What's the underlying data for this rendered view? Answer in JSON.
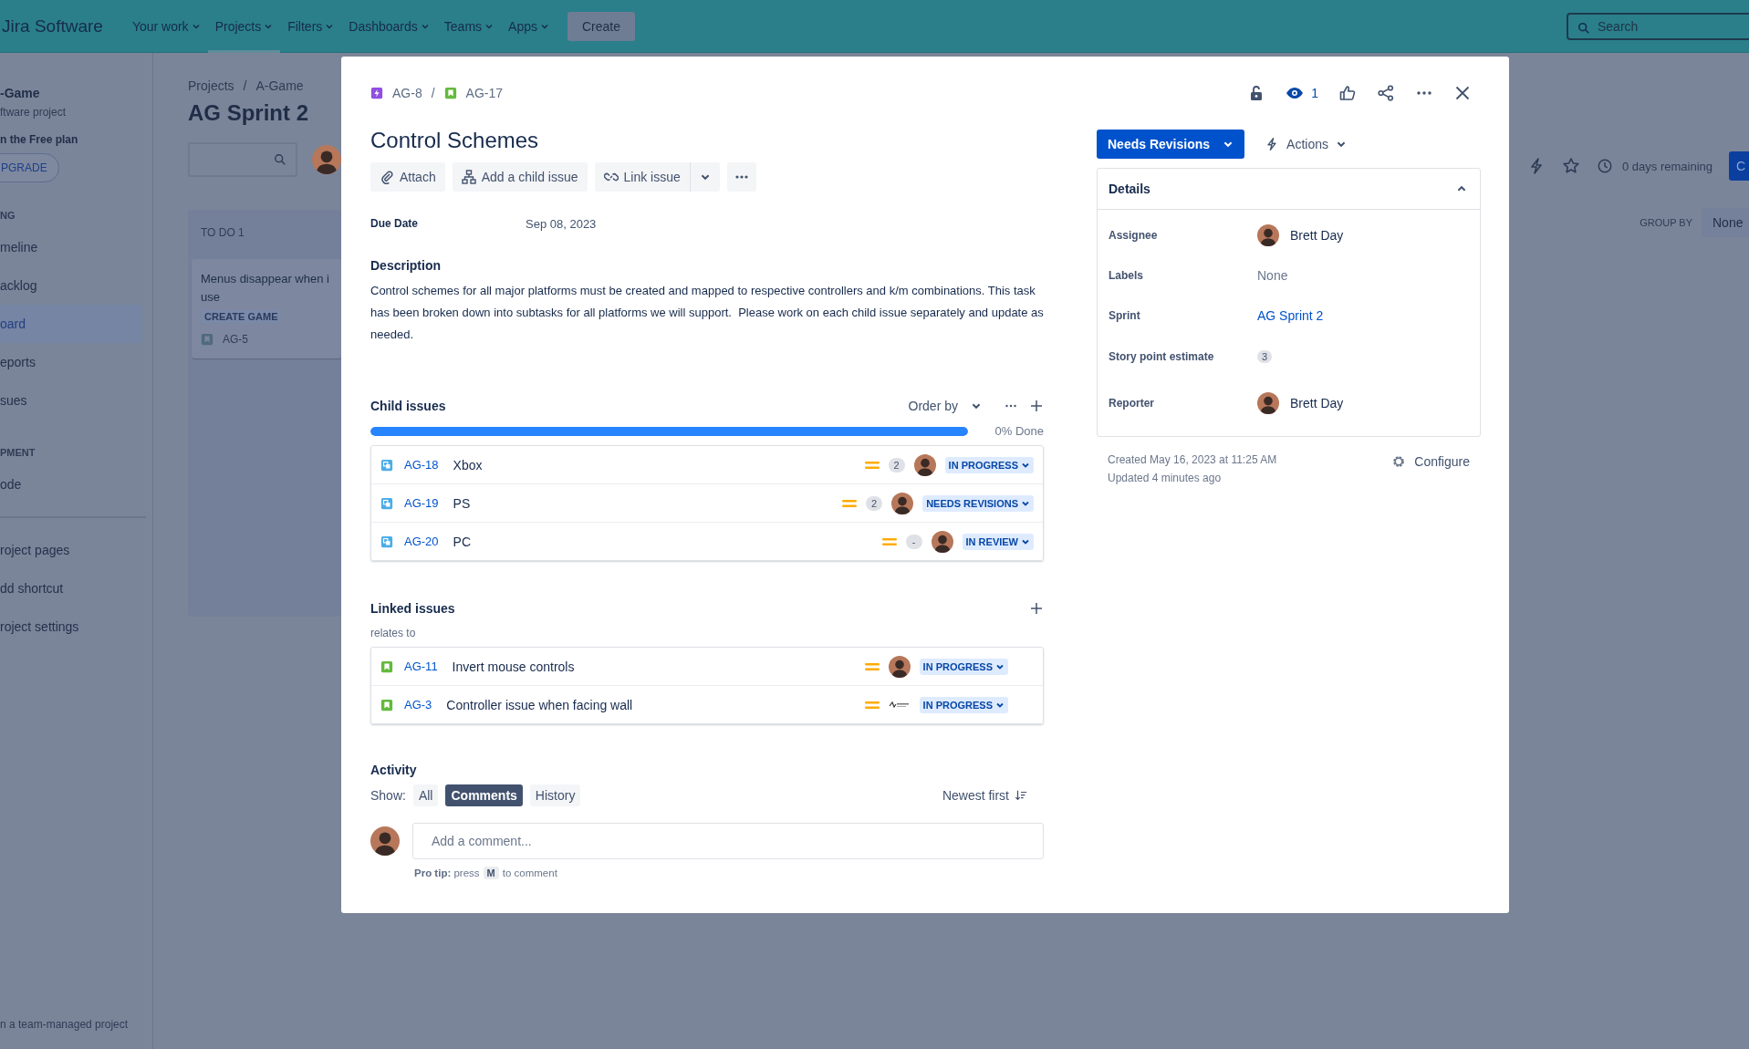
{
  "top_nav": {
    "product": "Jira Software",
    "items": [
      {
        "label": "Your work",
        "selected": false
      },
      {
        "label": "Projects",
        "selected": true
      },
      {
        "label": "Filters",
        "selected": false
      },
      {
        "label": "Dashboards",
        "selected": false
      },
      {
        "label": "Teams",
        "selected": false
      },
      {
        "label": "Apps",
        "selected": false
      }
    ],
    "create_button": "Create",
    "search": {
      "placeholder": "Search"
    }
  },
  "sidebar": {
    "project_name": "-Game",
    "project_type": "ftware project",
    "plan_note": "n the Free plan",
    "upgrade_button": "PGRADE",
    "sections": [
      {
        "heading": "NG",
        "items": [
          {
            "label": "meline",
            "selected": false
          },
          {
            "label": "acklog",
            "selected": false
          },
          {
            "label": "oard",
            "selected": true
          },
          {
            "label": "eports",
            "selected": false
          },
          {
            "label": "sues",
            "selected": false
          }
        ]
      },
      {
        "heading": "PMENT",
        "items": [
          {
            "label": "ode",
            "selected": false
          }
        ]
      }
    ],
    "links": [
      "roject pages",
      "dd shortcut",
      "roject settings"
    ],
    "footer": "n a team-managed project"
  },
  "board": {
    "breadcrumbs": [
      "Projects",
      "/",
      "A-Game"
    ],
    "title": "AG Sprint 2",
    "column": {
      "title": "TO DO 1",
      "card": {
        "title": "Menus disappear when i use",
        "epic": "CREATE GAME",
        "key": "AG-5"
      }
    },
    "days_remaining": "0 days remaining",
    "complete_button": "C",
    "group_by_label": "GROUP BY",
    "group_by_value": "None"
  },
  "issue": {
    "breadcrumbs": [
      "AG-8",
      "AG-17"
    ],
    "breadcrumb_separator": "/",
    "watchers": "1",
    "title": "Control Schemes",
    "toolbar": [
      "Attach",
      "Add a child issue",
      "Link issue"
    ],
    "due_date_label": "Due Date",
    "due_date": "Sep 08, 2023",
    "description_label": "Description",
    "description": "Control schemes for all major platforms must be created and mapped to respective controllers and k/m combinations. This task has been broken down into subtasks for all platforms we will support.  Please work on each child issue separately and update as needed.",
    "child_issues": {
      "title": "Child issues",
      "order_by": "Order by",
      "progress": {
        "level": 1,
        "reading": "0% Done"
      },
      "rows": [
        {
          "key": "AG-18",
          "summary": "Xbox",
          "story_points": "2",
          "status": "IN PROGRESS"
        },
        {
          "key": "AG-19",
          "summary": "PS",
          "story_points": "2",
          "status": "NEEDS REVISIONS"
        },
        {
          "key": "AG-20",
          "summary": "PC",
          "story_points": "-",
          "status": "IN REVIEW"
        }
      ]
    },
    "linked_issues": {
      "title": "Linked issues",
      "relation": "relates to",
      "rows": [
        {
          "key": "AG-11",
          "summary": "Invert mouse controls",
          "kind": "person",
          "status": "IN PROGRESS"
        },
        {
          "key": "AG-3",
          "summary": "Controller issue when facing wall",
          "kind": "logo",
          "status": "IN PROGRESS"
        }
      ]
    },
    "activity": {
      "title": "Activity",
      "show_label": "Show:",
      "filters": [
        {
          "label": "All",
          "selected": false
        },
        {
          "label": "Comments",
          "selected": true
        },
        {
          "label": "History",
          "selected": false
        }
      ],
      "sort": "Newest first",
      "comment_placeholder": "Add a comment...",
      "tip_bold": "Pro tip:",
      "tip_before": "press",
      "tip_key": "M",
      "tip_after": "to comment"
    },
    "status_button": "Needs Revisions",
    "actions_button": "Actions",
    "details": {
      "title": "Details",
      "expanded": true,
      "fields": [
        {
          "label": "Assignee",
          "kind": "user",
          "value": "Brett Day"
        },
        {
          "label": "Labels",
          "kind": "none",
          "value": "None"
        },
        {
          "label": "Sprint",
          "kind": "link",
          "value": "AG Sprint 2"
        },
        {
          "label": "Story point estimate",
          "kind": "badge",
          "value": "3"
        },
        {
          "label": "Reporter",
          "kind": "user",
          "value": "Brett Day"
        }
      ]
    },
    "created": "Created May 16, 2023 at 11:25 AM",
    "updated": "Updated 4 minutes ago",
    "configure": "Configure"
  }
}
